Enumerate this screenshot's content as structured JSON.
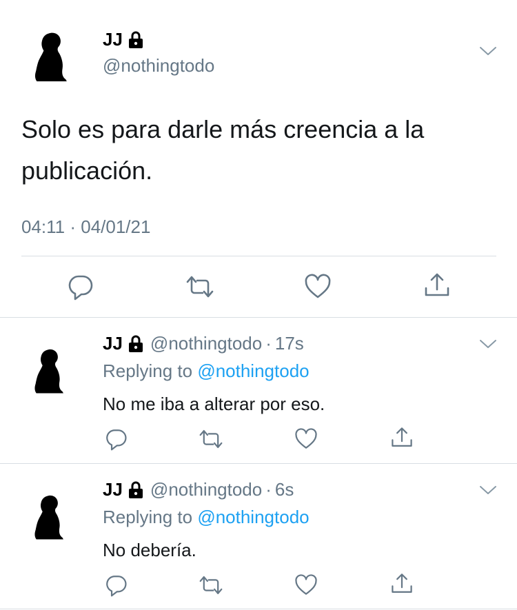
{
  "main_tweet": {
    "name": "JJ",
    "handle": "@nothingtodo",
    "text": "Solo es para darle más creencia a la publicación.",
    "timestamp": "04:11 · 04/01/21",
    "avatar_icon": "silhouette-avatar",
    "lock_icon": "lock-icon",
    "more_icon": "chevron-down-icon",
    "actions": [
      "reply-icon",
      "retweet-icon",
      "like-icon",
      "share-icon"
    ]
  },
  "replies": [
    {
      "name": "JJ",
      "handle": "@nothingtodo",
      "dot": "·",
      "time": "17s",
      "replying_prefix": "Replying to",
      "replying_to": "@nothingtodo",
      "text": "No me iba a alterar por eso."
    },
    {
      "name": "JJ",
      "handle": "@nothingtodo",
      "dot": "·",
      "time": "6s",
      "replying_prefix": "Replying to",
      "replying_to": "@nothingtodo",
      "text": "No debería."
    }
  ],
  "colors": {
    "secondary_text": "#657786",
    "mention": "#1da1f2",
    "separator": "#d8dee3",
    "icon": "#657786"
  }
}
